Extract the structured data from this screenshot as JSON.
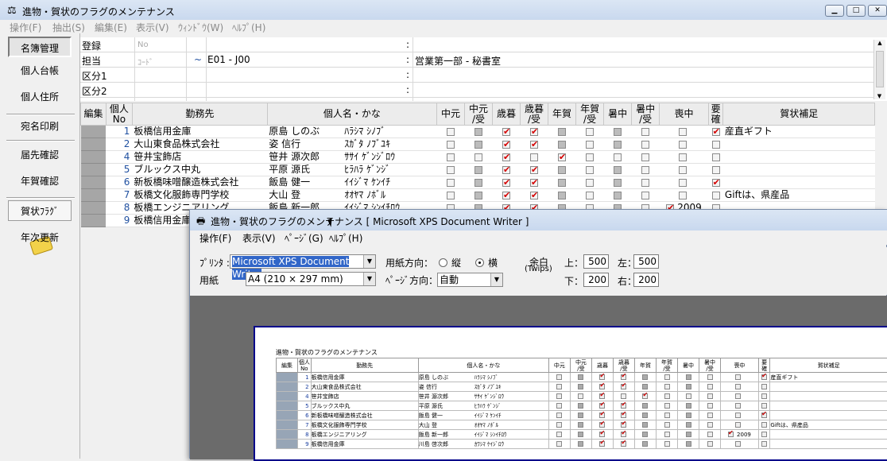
{
  "window": {
    "title": "進物・賀状のフラグのメンテナンス",
    "icon": "scale-icon"
  },
  "menu": [
    "操作(F)",
    "抽出(S)",
    "編集(E)",
    "表示(V)",
    "ｳｨﾝﾄﾞｳ(W)",
    "ﾍﾙﾌﾟ(H)"
  ],
  "nav": [
    "名簿管理",
    "個人台帳",
    "個人住所",
    "宛名印刷",
    "届先確認",
    "年賀確認",
    "賀状ﾌﾗｸﾞ",
    "年次更新"
  ],
  "form": {
    "rows": [
      {
        "label": "登録",
        "placeholder": "No",
        "value": "",
        "right": ""
      },
      {
        "label": "担当",
        "placeholder": "ｺｰﾄﾞ",
        "tilde": "~",
        "value": "E01 - J00",
        "right": "営業第一部 - 秘書室"
      },
      {
        "label": "区分1",
        "placeholder": "",
        "value": "",
        "right": ""
      },
      {
        "label": "区分2",
        "placeholder": "",
        "value": "",
        "right": ""
      }
    ],
    "colon": ":"
  },
  "grid": {
    "headers": [
      "編集",
      "個人\nNo",
      "勤務先",
      "個人名・かな",
      "中元",
      "中元\n/受",
      "歳暮",
      "歳暮\n/受",
      "年賀",
      "年賀\n/受",
      "暑中",
      "暑中\n/受",
      "喪中",
      "要\n確",
      "賀状補足"
    ],
    "rows": [
      {
        "no": "1",
        "company": "板橋信用金庫",
        "name": "原島 しのぶ",
        "kana": "ﾊﾗｼﾏ ｼﾉﾌﾞ",
        "flags": "uhcchuhuu",
        "mourning": "",
        "confirm": "c",
        "note": "産直ギフト"
      },
      {
        "no": "2",
        "company": "大山東食品株式会社",
        "name": "姿 信行",
        "kana": "ｽｶﾞﾀ ﾉﾌﾞﾕｷ",
        "flags": "uhcchuhuu",
        "mourning": "",
        "confirm": "u",
        "note": ""
      },
      {
        "no": "4",
        "company": "笹井宝飾店",
        "name": "笹井 源次郎",
        "kana": "ｻｻｲ ｹﾞﾝｼﾞﾛｳ",
        "flags": "uucucuuuu",
        "mourning": "",
        "confirm": "u",
        "note": ""
      },
      {
        "no": "5",
        "company": "ブルックス中丸",
        "name": "平原 源氏",
        "kana": "ﾋﾗﾊﾗ ｹﾞﾝｼﾞ",
        "flags": "uhcchuhuu",
        "mourning": "",
        "confirm": "u",
        "note": ""
      },
      {
        "no": "6",
        "company": "新板橋味噌醸造株式会社",
        "name": "飯島 健一",
        "kana": "ｲｲｼﾞﾏ ｹﾝｲﾁ",
        "flags": "uhcchuhuu",
        "mourning": "",
        "confirm": "c",
        "note": ""
      },
      {
        "no": "7",
        "company": "板橋文化服飾専門学校",
        "name": "大山 登",
        "kana": "ｵｵﾔﾏ ﾉﾎﾞﾙ",
        "flags": "uhcchuhuu",
        "mourning": "",
        "confirm": "u",
        "note": "Giftは、県産品"
      },
      {
        "no": "8",
        "company": "板橋エンジニアリング",
        "name": "飯島 新一郎",
        "kana": "ｲｲｼﾞﾏ ｼﾝｲﾁﾛｳ",
        "flags": "uhcchuhuc",
        "mourning": "2009",
        "confirm": "u",
        "note": ""
      },
      {
        "no": "9",
        "company": "板橋信用金庫",
        "name": "川島 啓次郎",
        "kana": "ｶﾜｼﾏ ｹｲｼﾞﾛｳ",
        "flags": "uhcchuhuu",
        "mourning": "",
        "confirm": "u",
        "note": ""
      }
    ]
  },
  "dialog": {
    "title": "進物・賀状のフラグのメンテナンス [ Microsoft XPS Document Writer ]",
    "icon": "printer-icon",
    "menu": [
      "操作(F)",
      "表示(V)",
      "ﾍﾟｰｼﾞ(G)",
      "ﾍﾙﾌﾟ(H)"
    ],
    "printer_label": "ﾌﾟﾘﾝﾀ :",
    "printer": "Microsoft XPS Document Writer",
    "paper_label": "用紙",
    "paper": "A4 (210 × 297 mm)",
    "orient_label": "用紙方向：",
    "orient_portrait": "縦",
    "orient_landscape": "横",
    "orient_selected": "横",
    "pagedir_label": "ﾍﾟｰｼﾞ方向：",
    "pagedir": "自動",
    "margin_label": "余白",
    "margin_unit": "(Twips)",
    "top_label": "上：",
    "top": "500",
    "left_label": "左：",
    "left": "500",
    "bottom_label": "下：",
    "bottom": "200",
    "right_label": "右：",
    "right": "200",
    "preview_title": "進物・賀状のフラグのメンテナンス"
  },
  "colors": {
    "check": "#d40000",
    "edit_cell": "#a6a6a6",
    "titlebar": "#c8d8ee",
    "preview_bg": "#6b6b6b"
  }
}
